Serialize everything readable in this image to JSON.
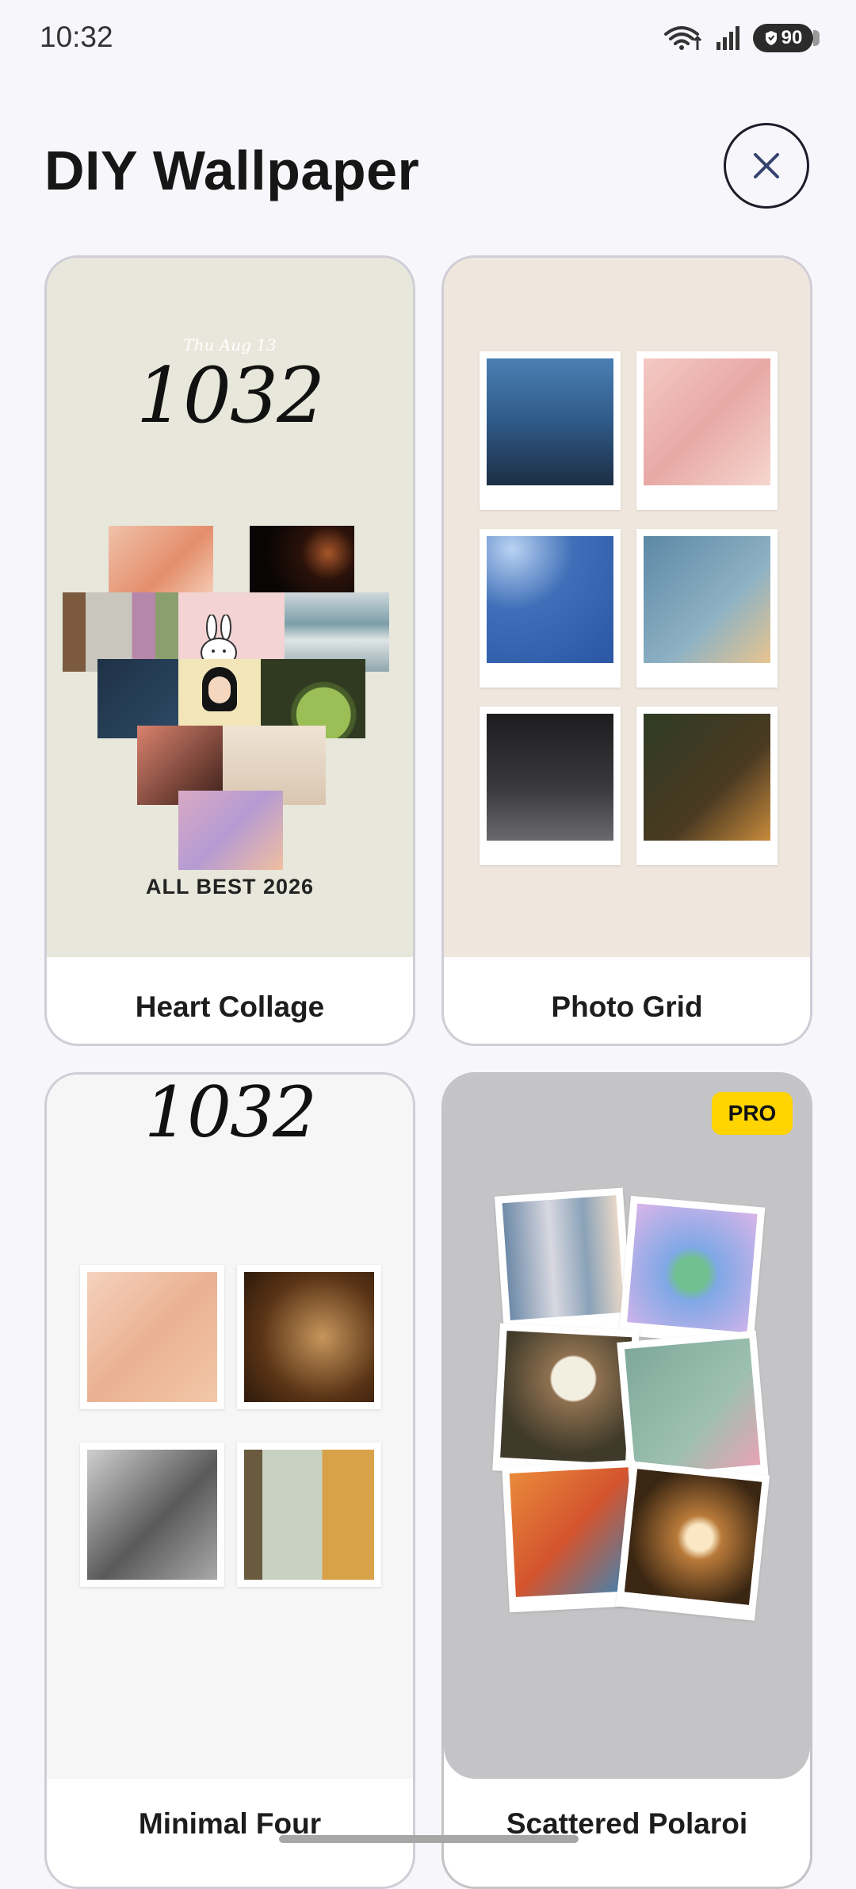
{
  "status_bar": {
    "time": "10:32",
    "battery": "90",
    "icons": [
      "wifi-icon",
      "signal-icon",
      "battery-icon"
    ]
  },
  "header": {
    "title": "DIY Wallpaper",
    "close_icon": "close-icon"
  },
  "templates": [
    {
      "name": "Heart Collage",
      "preview": {
        "date": "Thu Aug 13",
        "time": "1032",
        "footer": "ALL BEST 2026"
      }
    },
    {
      "name": "Photo Grid",
      "preview": {}
    },
    {
      "name": "Minimal Four",
      "preview": {
        "time": "1032"
      }
    },
    {
      "name": "Scattered Polaroi",
      "preview": {},
      "badge": "PRO"
    }
  ],
  "colors": {
    "background": "#f7f6fa",
    "pro_badge": "#ffd400",
    "heart_card_bg": "#e8e7db",
    "grid_card_bg": "#efe7dd",
    "minimal_card_bg": "#f6f6f6",
    "scatter_card_bg": "#c4c4c6"
  }
}
